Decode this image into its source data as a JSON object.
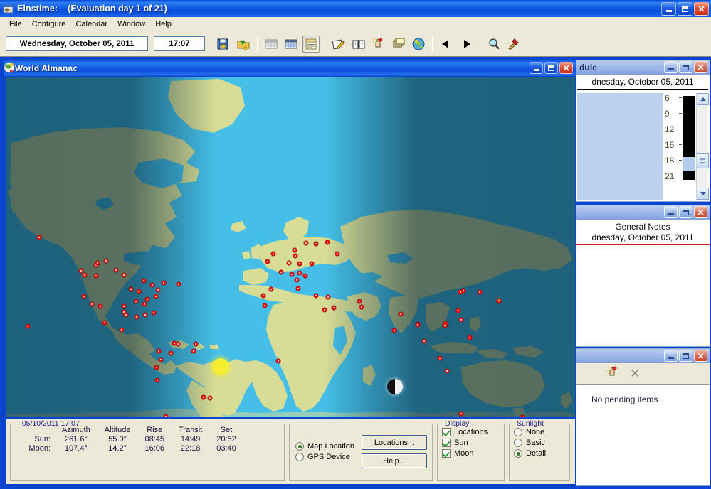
{
  "app": {
    "title": "Einstime:",
    "evaluation": "(Evaluation day 1 of 21)",
    "icon": "app-icon"
  },
  "menu": {
    "items": [
      {
        "label": "File"
      },
      {
        "label": "Configure"
      },
      {
        "label": "Calendar"
      },
      {
        "label": "Window"
      },
      {
        "label": "Help"
      }
    ]
  },
  "toolbar": {
    "date_value": "Wednesday, October 05, 2011",
    "time_value": "17:07",
    "buttons": [
      {
        "name": "save-icon"
      },
      {
        "name": "export-icon"
      },
      {
        "name": "month-grid-icon"
      },
      {
        "name": "calendar-icon"
      },
      {
        "name": "day-list-icon"
      },
      {
        "name": "edit-note-icon"
      },
      {
        "name": "book-icon"
      },
      {
        "name": "alarm-hand-icon"
      },
      {
        "name": "print-icon"
      },
      {
        "name": "world-almanac-icon"
      },
      {
        "name": "prev-icon"
      },
      {
        "name": "next-icon"
      },
      {
        "name": "search-icon"
      },
      {
        "name": "tools-icon"
      }
    ]
  },
  "almanac": {
    "title": "World Almanac",
    "info": {
      "legend": ": 05/10/2011  17:07",
      "columns": [
        "Azimuth",
        "Altitude",
        "Rise",
        "Transit",
        "Set"
      ],
      "rows": [
        {
          "label": "Sun:",
          "values": [
            "261.6°",
            "55.0°",
            "08:45",
            "14:49",
            "20:52"
          ]
        },
        {
          "label": "Moon:",
          "values": [
            "107.4°",
            "14.2°",
            "16:06",
            "22:18",
            "03:40"
          ]
        }
      ]
    },
    "source": {
      "options": [
        {
          "label": "Map Location",
          "selected": true
        },
        {
          "label": "GPS Device",
          "selected": false
        }
      ],
      "buttons": [
        {
          "label": "Locations..."
        },
        {
          "label": "Help..."
        }
      ]
    },
    "display": {
      "title": "Display",
      "options": [
        {
          "label": "Locations",
          "checked": true
        },
        {
          "label": "Sun",
          "checked": true
        },
        {
          "label": "Moon",
          "checked": true
        }
      ]
    },
    "sunlight": {
      "title": "Sunlight",
      "options": [
        {
          "label": "None",
          "selected": false
        },
        {
          "label": "Basic",
          "selected": false
        },
        {
          "label": "Detail",
          "selected": true
        }
      ]
    },
    "map": {
      "sun_marker": "sun-marker",
      "moon_marker": "moon-marker",
      "ocean_color": "#45bfe8",
      "land_color": "#d7dd96",
      "night_color": "#2a5f73"
    }
  },
  "schedule": {
    "title": "dule",
    "date": "dnesday, October 05, 2011",
    "scale_labels": [
      "6",
      "9",
      "12",
      "15",
      "18",
      "21"
    ]
  },
  "notes": {
    "title": "",
    "heading": "General Notes",
    "date": "dnesday, October 05, 2011"
  },
  "tasks": {
    "title": "",
    "empty_text": "No pending items",
    "toolbar": [
      {
        "name": "new-task-icon"
      },
      {
        "name": "delete-task-icon"
      }
    ]
  },
  "window_controls": {
    "minimize": "minimize-button",
    "maximize": "maximize-button",
    "close": "close-button"
  }
}
